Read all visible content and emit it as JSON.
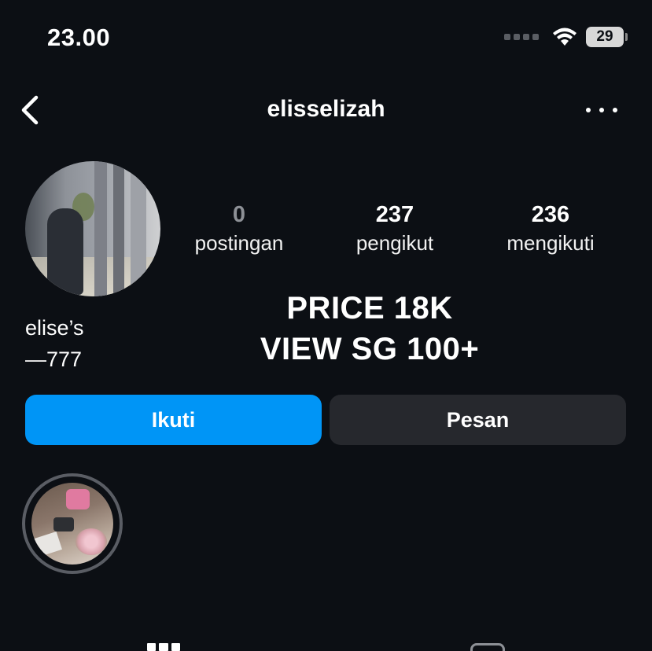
{
  "status_bar": {
    "time": "23.00",
    "battery": "29",
    "icons": [
      "signal-icon",
      "wifi-icon",
      "battery-icon"
    ]
  },
  "nav": {
    "back_icon": "chevron-left-icon",
    "username": "elisselizah",
    "more_icon": "more-horizontal-icon"
  },
  "profile": {
    "avatar": "profile-avatar",
    "stats": [
      {
        "value": "0",
        "label": "postingan"
      },
      {
        "value": "237",
        "label": "pengikut"
      },
      {
        "value": "236",
        "label": "mengikuti"
      }
    ],
    "bio_name": "elise’s",
    "bio_line": "—777",
    "promo_line1": "PRICE 18K",
    "promo_line2": "VIEW SG 100+"
  },
  "actions": {
    "follow_label": "Ikuti",
    "message_label": "Pesan"
  },
  "highlights": [
    {
      "icon": "story-highlight"
    }
  ],
  "tabs": [
    {
      "icon": "grid-icon"
    },
    {
      "icon": "tagged-icon"
    }
  ],
  "colors": {
    "background": "#0c0f14",
    "accent": "#0095f6",
    "secondary_button": "#26282d"
  }
}
